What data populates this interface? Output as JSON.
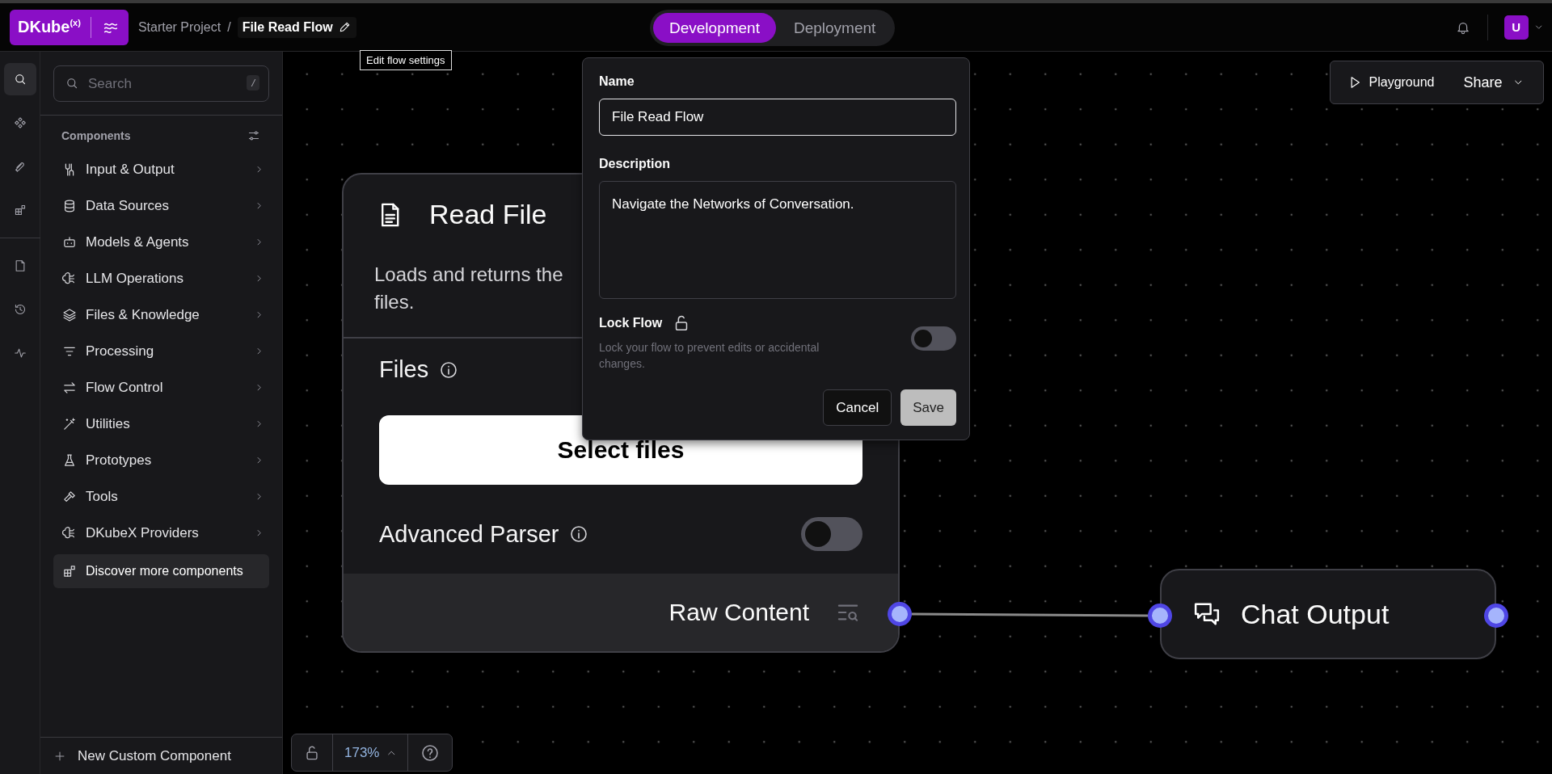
{
  "header": {
    "logo": "DKube$^{(x)}$",
    "breadcrumb": {
      "project": "Starter Project",
      "separator": "/",
      "flow": "File Read Flow"
    },
    "tooltip": "Edit flow settings",
    "mode_tabs": [
      {
        "label": "Development",
        "selected": true
      },
      {
        "label": "Deployment",
        "selected": false
      }
    ],
    "avatar": "U"
  },
  "icon_rail": [
    {
      "selected": true
    },
    {
      "selected": false
    },
    {
      "selected": false
    },
    {
      "selected": false
    },
    {
      "selected": false
    },
    {
      "selected": false
    },
    {
      "selected": false
    }
  ],
  "sidebar": {
    "search": {
      "placeholder": "Search",
      "shortcut": "/"
    },
    "section_title": "Components",
    "items": [
      {
        "label": "Input & Output"
      },
      {
        "label": "Data Sources"
      },
      {
        "label": "Models & Agents"
      },
      {
        "label": "LLM Operations"
      },
      {
        "label": "Files & Knowledge"
      },
      {
        "label": "Processing"
      },
      {
        "label": "Flow Control"
      },
      {
        "label": "Utilities"
      },
      {
        "label": "Prototypes"
      },
      {
        "label": "Tools"
      },
      {
        "label": "DKubeX Providers"
      }
    ],
    "discover": "Discover more components",
    "new_component": "New Custom Component"
  },
  "toolbar": {
    "playground": "Playground",
    "share": "Share"
  },
  "nodes": [
    {
      "kind": "full",
      "title": "Read File",
      "description": [
        "Loads and returns the",
        "files."
      ],
      "fields": [
        {
          "kind": "file",
          "label": "Files",
          "button": "Select files"
        },
        {
          "kind": "toggle",
          "label": "Advanced Parser",
          "on": false
        }
      ],
      "output": "Raw Content"
    },
    {
      "kind": "compact",
      "title": "Chat Output"
    }
  ],
  "popover": {
    "name_label": "Name",
    "name_value": "File Read Flow",
    "description_label": "Description",
    "description_value": "Navigate the Networks of Conversation.",
    "lock_label": "Lock Flow",
    "lock_hint": "Lock your flow to prevent edits or accidental changes.",
    "locked": false,
    "cancel": "Cancel",
    "save": "Save"
  },
  "zoom_controls": {
    "zoom": "173%"
  }
}
